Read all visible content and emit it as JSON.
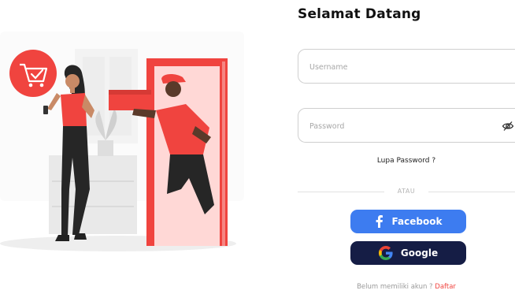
{
  "login": {
    "title": "Selamat Datang",
    "username_placeholder": "Username",
    "password_placeholder": "Password",
    "forgot_password": "Lupa Password ?",
    "divider_text": "ATAU",
    "facebook_label": "Facebook",
    "google_label": "Google",
    "signup_prompt": "Belum memiliki akun ?",
    "signup_link": "Daftar"
  },
  "colors": {
    "accent": "#f0443f",
    "facebook": "#3d7cf0",
    "google_button": "#151d45",
    "text": "#111111"
  },
  "icons": {
    "password_toggle": "eye-slash-icon",
    "facebook": "facebook-icon",
    "google": "google-icon",
    "cart_bubble": "shopping-cart-check-icon"
  }
}
